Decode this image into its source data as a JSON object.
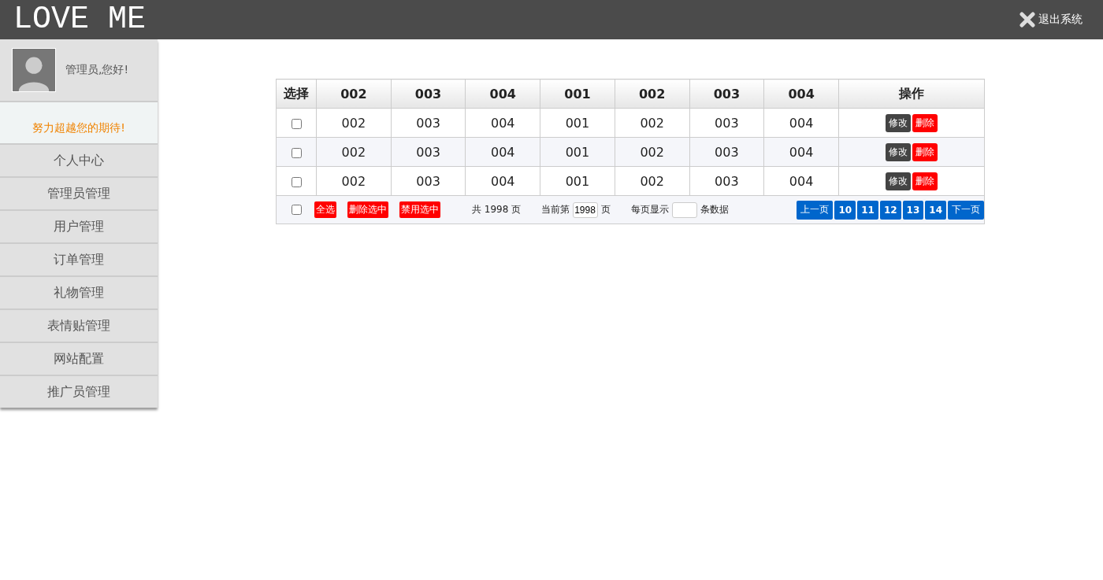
{
  "header": {
    "logo": "LOVE ME",
    "logout": "退出系统"
  },
  "sidebar": {
    "greeting": "管理员,您好!",
    "slogan": "努力超越您的期待!",
    "items": [
      {
        "label": "个人中心"
      },
      {
        "label": "管理员管理"
      },
      {
        "label": "用户管理"
      },
      {
        "label": "订单管理"
      },
      {
        "label": "礼物管理"
      },
      {
        "label": "表情贴管理"
      },
      {
        "label": "网站配置"
      },
      {
        "label": "推广员管理"
      }
    ]
  },
  "table": {
    "select_header": "选择",
    "columns": [
      "002",
      "003",
      "004",
      "001",
      "002",
      "003",
      "004"
    ],
    "actions_header": "操作",
    "rows": [
      {
        "checked": false,
        "cells": [
          "002",
          "003",
          "004",
          "001",
          "002",
          "003",
          "004"
        ],
        "actions": [
          "修改",
          "删除"
        ]
      },
      {
        "checked": false,
        "cells": [
          "002",
          "003",
          "004",
          "001",
          "002",
          "003",
          "004"
        ],
        "actions": [
          "修改",
          "删除"
        ]
      },
      {
        "checked": false,
        "cells": [
          "002",
          "003",
          "004",
          "001",
          "002",
          "003",
          "004"
        ],
        "actions": [
          "修改",
          "删除"
        ]
      }
    ],
    "footer": {
      "select_all_checked": false,
      "buttons": [
        "全选",
        "删除选中",
        "禁用选中"
      ],
      "total": "共 1998 页",
      "current_label": "当前第",
      "current_value": "1998",
      "current_unit": "页",
      "per_page_label": "每页显示",
      "per_page_unit": "条数据",
      "pagination": {
        "prev": "上一页",
        "pages": [
          "10",
          "11",
          "12",
          "13",
          "14"
        ],
        "next": "下一页"
      }
    }
  }
}
